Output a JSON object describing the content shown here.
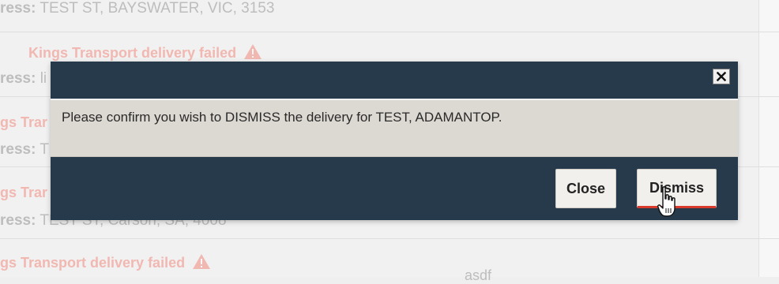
{
  "background": {
    "rows": [
      {
        "address_label": "ress:",
        "address_value": "TEST ST, BAYSWATER, VIC, 3153"
      },
      {
        "alert": "Kings Transport delivery failed",
        "address_label": "ress:",
        "address_value": "li"
      },
      {
        "alert": "gs Trar",
        "address_label": "ress:",
        "address_value": "T"
      },
      {
        "alert": "gs Trar",
        "address_label": "ress:",
        "address_value": "TEST ST, Carson, SA, 4008"
      },
      {
        "alert": "gs Transport delivery failed",
        "note": "asdf"
      }
    ]
  },
  "dialog": {
    "message": "Please confirm you wish to DISMISS the delivery for TEST, ADAMANTOP.",
    "close_label": "Close",
    "dismiss_label": "Dismiss",
    "close_icon": "close-x-icon"
  },
  "colors": {
    "modal_header": "#263a4c",
    "modal_body": "#dcd8d2",
    "dismiss_accent": "#d93a2b",
    "alert_text": "#f1b8b2"
  }
}
